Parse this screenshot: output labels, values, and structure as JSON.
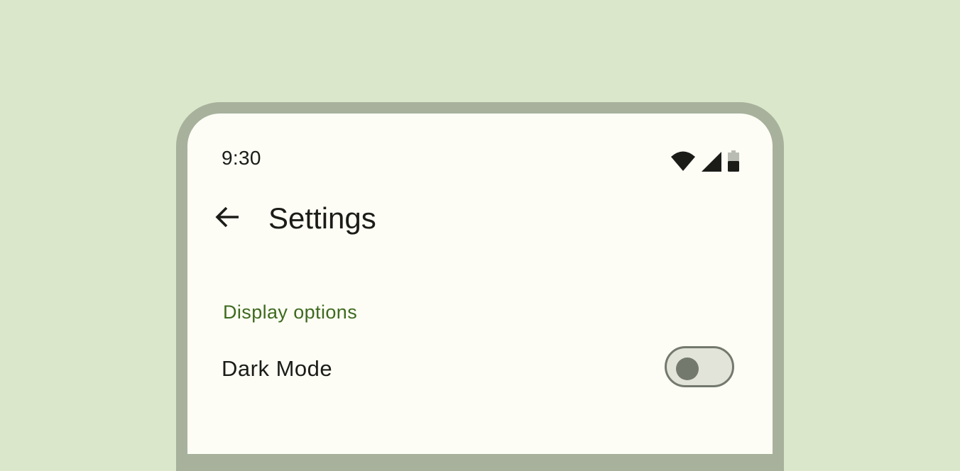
{
  "status_bar": {
    "time": "9:30",
    "icons": [
      "wifi-icon",
      "cellular-signal-icon",
      "battery-icon"
    ]
  },
  "top_bar": {
    "back_icon": "arrow-back-icon",
    "title": "Settings"
  },
  "section": {
    "header": "Display options",
    "items": [
      {
        "label": "Dark Mode",
        "control": "switch",
        "checked": false
      }
    ]
  },
  "colors": {
    "background": "#dbe7cb",
    "phone_frame": "#a7b19c",
    "screen": "#fdfdf5",
    "accent": "#3e6a1f",
    "on_surface": "#1b1c18",
    "outline": "#74796d",
    "switch_track_off": "#e2e4da"
  }
}
